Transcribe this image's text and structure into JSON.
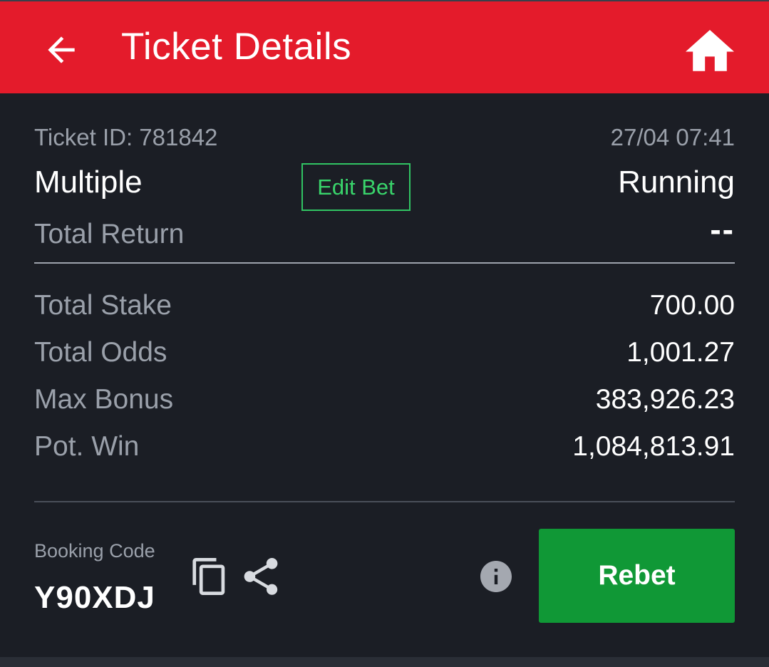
{
  "header": {
    "title": "Ticket Details",
    "back_icon": "arrow-left-icon",
    "home_icon": "home-icon",
    "bg_color": "#e41b2b"
  },
  "ticket": {
    "id_text": "Ticket ID: 781842",
    "datetime": "27/04 07:41",
    "bet_type": "Multiple",
    "edit_bet_label": "Edit Bet",
    "status": "Running",
    "total_return_label": "Total Return",
    "total_return_value": "--"
  },
  "summary": [
    {
      "label": "Total Stake",
      "value": "700.00"
    },
    {
      "label": "Total Odds",
      "value": "1,001.27"
    },
    {
      "label": "Max Bonus",
      "value": "383,926.23"
    },
    {
      "label": "Pot. Win",
      "value": "1,084,813.91"
    }
  ],
  "booking": {
    "label": "Booking Code",
    "code": "Y90XDJ",
    "copy_icon": "copy-icon",
    "share_icon": "share-icon",
    "info_icon": "info-icon"
  },
  "actions": {
    "rebet_label": "Rebet",
    "rebet_color": "#109836",
    "accent_green": "#39d46b"
  }
}
